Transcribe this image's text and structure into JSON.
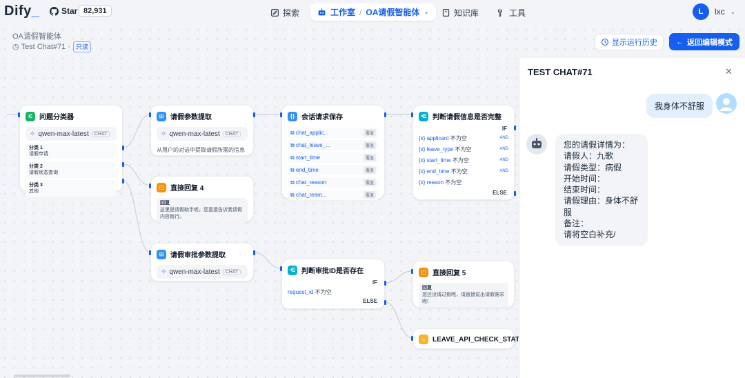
{
  "header": {
    "logo": "Dify",
    "github_label": "Star",
    "github_count": "82,931",
    "nav_explore": "探索",
    "nav_studio": "工作室",
    "nav_separator": "/",
    "nav_app_name": "OA请假智能体",
    "nav_knowledge": "知识库",
    "nav_tools": "工具",
    "user_initial": "L",
    "user_name": "lxc"
  },
  "workflow": {
    "app_title": "OA请假智能体",
    "run_label": "Test Chat#71 ·",
    "readonly_badge": "只读",
    "history_button": "显示运行历史",
    "back_button": "返回编辑模式"
  },
  "nodes": {
    "classifier": {
      "title": "问题分类器",
      "model": "qwen-max-latest",
      "chat_tag": "CHAT",
      "classes": [
        {
          "name": "分类 1",
          "text": "请假申请"
        },
        {
          "name": "分类 2",
          "text": "请假状态查询"
        },
        {
          "name": "分类 3",
          "text": "其他"
        }
      ]
    },
    "param_extract": {
      "title": "请假参数提取",
      "model": "qwen-max-latest",
      "chat_tag": "CHAT",
      "desc": "从用户的对话中提取请假所需的信息"
    },
    "direct_reply_4": {
      "title": "直接回复 4",
      "label": "回复",
      "text": "这里是请假助手呢，您直接告诉我请假内容就行。"
    },
    "session_save": {
      "title": "会话请求保存",
      "vars": [
        "chat_applic...",
        "chat_leave_...",
        "start_time",
        "end_time",
        "chat_reason",
        "chat_ream..."
      ],
      "var_tag": "覆盖"
    },
    "check_info": {
      "title": "判断请假信息是否完整",
      "if_label": "IF",
      "else_label": "ELSE",
      "conditions": [
        {
          "var": "applicant",
          "op": "不为空",
          "and": "AND"
        },
        {
          "var": "leave_type",
          "op": "不为空",
          "and": "AND"
        },
        {
          "var": "start_time",
          "op": "不为空",
          "and": "AND"
        },
        {
          "var": "end_time",
          "op": "不为空",
          "and": "AND"
        },
        {
          "var": "reason",
          "op": "不为空",
          "and": ""
        }
      ]
    },
    "approval_extract": {
      "title": "请假审批参数提取",
      "model": "qwen-max-latest",
      "chat_tag": "CHAT"
    },
    "check_id": {
      "title": "判断审批ID是否存在",
      "if_label": "IF",
      "else_label": "ELSE",
      "condition_var": "request_id",
      "condition_op": "不为空"
    },
    "direct_reply_5": {
      "title": "直接回复 5",
      "label": "回复",
      "text": "您还没请过假呢，请直接说出请假需求呢!"
    },
    "leave_api": {
      "title": "LEAVE_API_CHECK_STATUS"
    }
  },
  "chat": {
    "title": "TEST CHAT#71",
    "user_message": "我身体不舒服",
    "bot_lines": [
      "您的请假详情为：",
      "请假人：九歌",
      "请假类型：病假",
      "开始时间：",
      "结束时间：",
      "请假理由：身体不舒服",
      "备注：",
      "请将空白补充/"
    ]
  }
}
